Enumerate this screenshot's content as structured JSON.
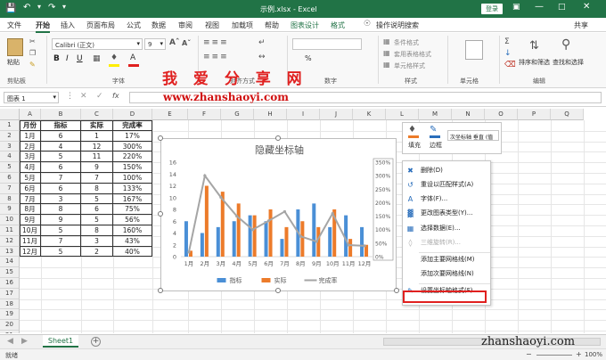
{
  "titlebar": {
    "filename": "示例.xlsx",
    "app": "Excel",
    "separator": " - ",
    "login": "登录"
  },
  "tabs": [
    "文件",
    "开始",
    "插入",
    "页面布局",
    "公式",
    "数据",
    "审阅",
    "视图",
    "加载项",
    "帮助",
    "图表设计",
    "格式"
  ],
  "tabs_active": "开始",
  "tell_me": "操作说明搜索",
  "share": "共享",
  "ribbon": {
    "paste": "粘贴",
    "clipboard": "剪贴板",
    "font_name": "Calibri (正文)",
    "font_size": "9",
    "font_group": "字体",
    "align_group": "对齐方式",
    "number_group": "数字",
    "percent": "%",
    "cond_format": "条件格式",
    "table_format": "套用表格格式",
    "cell_style": "单元格样式",
    "styles_group": "样式",
    "cells": "单元格",
    "sort_filter": "排序和筛选",
    "find_select": "查找和选择",
    "editing_group": "编辑"
  },
  "watermark": {
    "title": "我 爱 分 享 网",
    "url": "www.zhanshaoyi.com",
    "footer_url": "zhanshaoyi.com"
  },
  "formula": {
    "namebox": "图表 1",
    "fx": "fx"
  },
  "columns": [
    "A",
    "B",
    "C",
    "D",
    "E",
    "F",
    "G",
    "H",
    "I",
    "J",
    "K",
    "L",
    "M",
    "N",
    "O",
    "P",
    "Q"
  ],
  "rows": [
    "1",
    "2",
    "3",
    "4",
    "5",
    "6",
    "7",
    "8",
    "9",
    "10",
    "11",
    "12",
    "13",
    "14",
    "15",
    "16",
    "17",
    "18",
    "19",
    "20",
    "21"
  ],
  "table": {
    "headers": [
      "月份",
      "指标",
      "实际",
      "完成率"
    ],
    "rows": [
      [
        "1月",
        "6",
        "1",
        "17%"
      ],
      [
        "2月",
        "4",
        "12",
        "300%"
      ],
      [
        "3月",
        "5",
        "11",
        "220%"
      ],
      [
        "4月",
        "6",
        "9",
        "150%"
      ],
      [
        "5月",
        "7",
        "7",
        "100%"
      ],
      [
        "6月",
        "6",
        "8",
        "133%"
      ],
      [
        "7月",
        "3",
        "5",
        "167%"
      ],
      [
        "8月",
        "8",
        "6",
        "75%"
      ],
      [
        "9月",
        "9",
        "5",
        "56%"
      ],
      [
        "10月",
        "5",
        "8",
        "160%"
      ],
      [
        "11月",
        "7",
        "3",
        "43%"
      ],
      [
        "12月",
        "5",
        "2",
        "40%"
      ]
    ]
  },
  "chart_data": {
    "type": "bar",
    "title": "隐藏坐标轴",
    "categories": [
      "1月",
      "2月",
      "3月",
      "4月",
      "5月",
      "6月",
      "7月",
      "8月",
      "9月",
      "10月",
      "11月",
      "12月"
    ],
    "series": [
      {
        "name": "指标",
        "type": "bar",
        "values": [
          6,
          4,
          5,
          6,
          7,
          6,
          3,
          8,
          9,
          5,
          7,
          5
        ],
        "color": "#4a8fd6"
      },
      {
        "name": "实际",
        "type": "bar",
        "values": [
          1,
          12,
          11,
          9,
          7,
          8,
          5,
          6,
          5,
          8,
          3,
          2
        ],
        "color": "#ec7b2a"
      },
      {
        "name": "完成率",
        "type": "line",
        "values": [
          0.17,
          3.0,
          2.2,
          1.5,
          1.0,
          1.33,
          1.67,
          0.75,
          0.56,
          1.6,
          0.43,
          0.4
        ],
        "color": "#a5a5a5"
      }
    ],
    "y_ticks": [
      "16",
      "14",
      "12",
      "10",
      "8",
      "6",
      "4",
      "2",
      "0"
    ],
    "ylim": [
      0,
      16
    ],
    "y2_ticks": [
      "350%",
      "300%",
      "250%",
      "200%",
      "150%",
      "100%",
      "50%",
      "0%"
    ],
    "y2lim": [
      0,
      3.5
    ],
    "legend_position": "bottom"
  },
  "minitoolbar": {
    "fill": "填充",
    "outline": "边框",
    "axis_select": "次坐标轴 垂直 (值"
  },
  "contextmenu": [
    {
      "icon": "delete-icon",
      "label": "删除(D)"
    },
    {
      "icon": "reset-icon",
      "label": "重设以匹配样式(A)"
    },
    {
      "icon": "font-icon",
      "label": "字体(F)..."
    },
    {
      "icon": "chart-type-icon",
      "label": "更改图表类型(Y)..."
    },
    {
      "icon": "select-data-icon",
      "label": "选择数据(E)..."
    },
    {
      "icon": "rotate-icon",
      "label": "三维旋转(R)..."
    },
    {
      "icon": "",
      "label": "添加主要网格线(M)"
    },
    {
      "icon": "",
      "label": "添加次要网格线(N)"
    },
    {
      "icon": "format-axis-icon",
      "label": "设置坐标轴格式(F)..."
    }
  ],
  "sheet": {
    "name": "Sheet1",
    "add": "+"
  },
  "status": {
    "ready": "就绪",
    "zoom": "100%"
  }
}
